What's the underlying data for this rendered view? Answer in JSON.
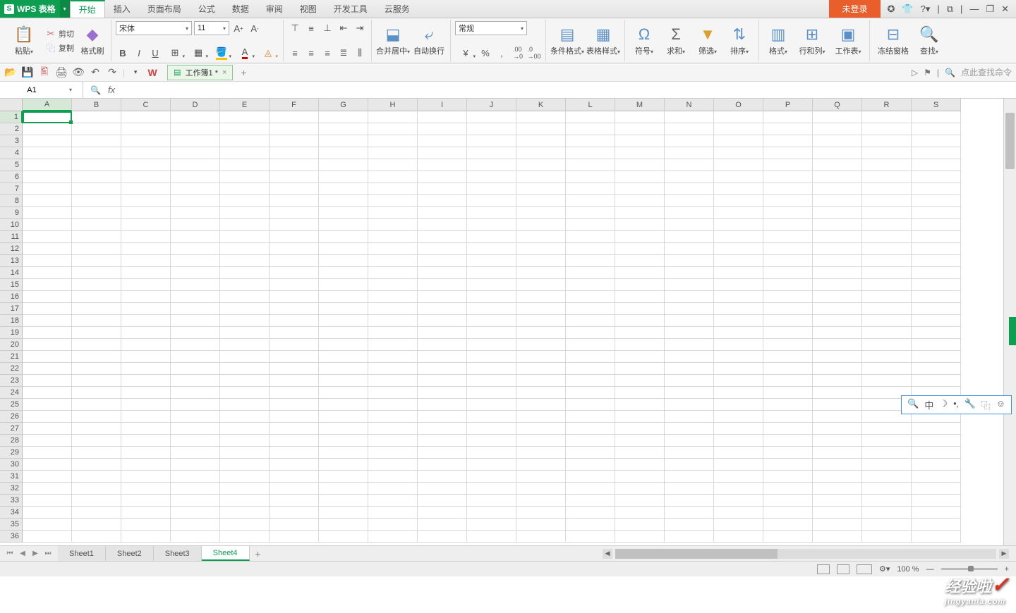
{
  "app": {
    "brand": "WPS 表格"
  },
  "menu": {
    "tabs": [
      "开始",
      "插入",
      "页面布局",
      "公式",
      "数据",
      "审阅",
      "视图",
      "开发工具",
      "云服务"
    ],
    "active": 0
  },
  "login": {
    "label": "未登录"
  },
  "win_ctrls": {
    "help": "?▾",
    "min": "—",
    "max": "❐",
    "close": "✕",
    "cloud": "☁",
    "shirt": "👕",
    "up": "⬆"
  },
  "ribbon": {
    "paste": "粘贴",
    "cut": "剪切",
    "copy": "复制",
    "format_painter": "格式刷",
    "font_name": "宋体",
    "font_size": "11",
    "merge_center": "合并居中",
    "wrap_text": "自动换行",
    "number_format": "常规",
    "cond_fmt": "条件格式",
    "table_style": "表格样式",
    "symbol": "符号",
    "sum": "求和",
    "filter": "筛选",
    "sort": "排序",
    "format": "格式",
    "row_col": "行和列",
    "worksheet": "工作表",
    "freeze": "冻结窗格",
    "find": "查找"
  },
  "qat": {
    "search_placeholder": "点此查找命令"
  },
  "doc_tab": {
    "name": "工作簿1 *"
  },
  "name_box": {
    "value": "A1"
  },
  "columns": [
    "A",
    "B",
    "C",
    "D",
    "E",
    "F",
    "G",
    "H",
    "I",
    "J",
    "K",
    "L",
    "M",
    "N",
    "O",
    "P",
    "Q",
    "R",
    "S"
  ],
  "rows": 36,
  "sheets": {
    "items": [
      "Sheet1",
      "Sheet2",
      "Sheet3",
      "Sheet4"
    ],
    "active": 3
  },
  "status": {
    "zoom": "100 %"
  },
  "watermark": {
    "text": "经验啦",
    "sub": "jingyanla.com"
  }
}
